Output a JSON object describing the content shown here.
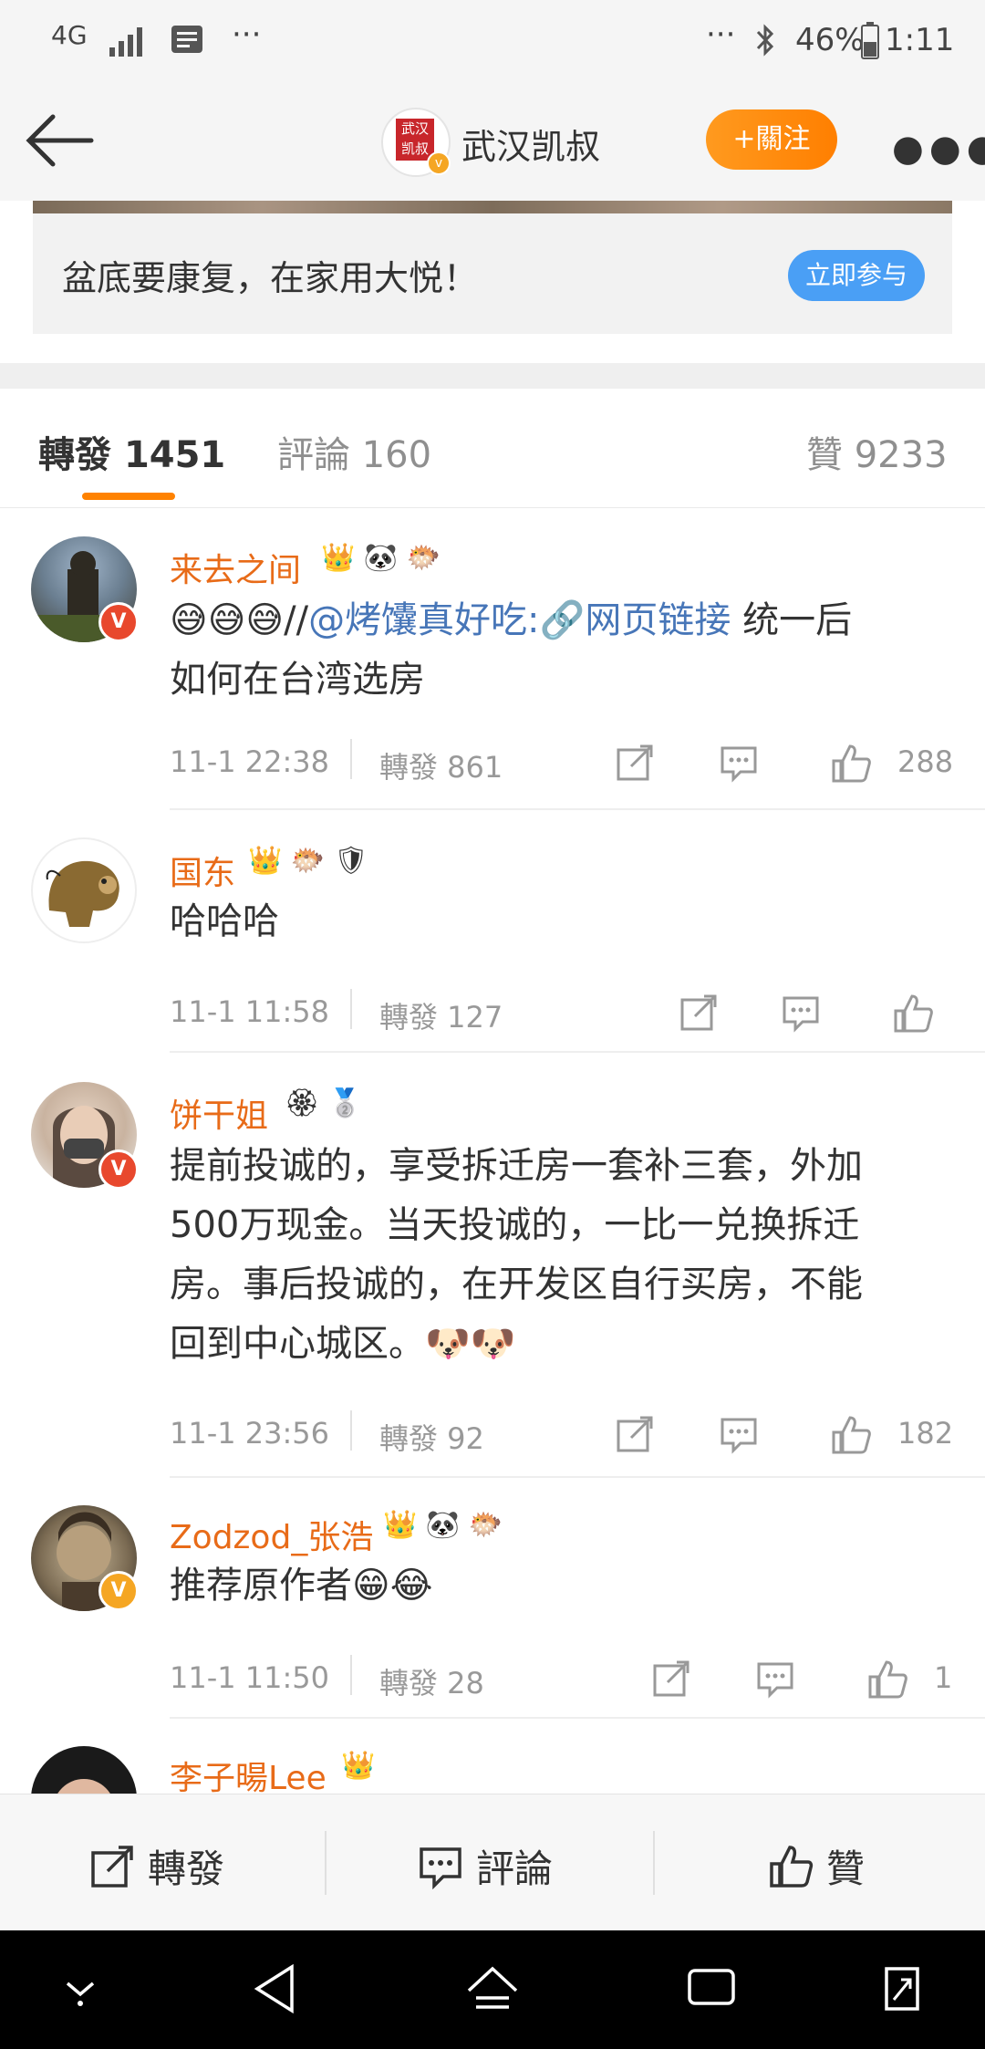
{
  "status_bar": {
    "network": "4G",
    "left_more": "···",
    "right_more": "···",
    "battery": "46%",
    "time": "1:11"
  },
  "nav": {
    "account_name": "武汉凯叔",
    "follow_label": "+關注",
    "avatar_text": "武汉凯叔"
  },
  "banner": {
    "text": "盆底要康复，在家用大悦！",
    "button": "立即参与"
  },
  "tabs": [
    {
      "label": "轉發",
      "count": "1451"
    },
    {
      "label": "評論",
      "count": "160"
    },
    {
      "label": "贊",
      "count": "9233"
    }
  ],
  "comments": [
    {
      "user": "来去之间",
      "text_mention": "@烤馕真好吃:",
      "text_link": "网页链接",
      "text_tail": "统一后",
      "text_line2": "如何在台湾选房",
      "prefix": "//",
      "date": "11-1 22:38",
      "forward_label": "轉發 861",
      "likes": "288"
    },
    {
      "user": "国东",
      "text": "哈哈哈",
      "date": "11-1 11:58",
      "forward_label": "轉發 127",
      "likes": ""
    },
    {
      "user": "饼干姐",
      "text_lines": [
        "提前投诚的，享受拆迁房一套补三套，外加",
        "500万现金。当天投诚的，一比一兑换拆迁",
        "房。事后投诚的，在开发区自行买房，不能",
        "回到中心城区。"
      ],
      "date": "11-1 23:56",
      "forward_label": "轉發 92",
      "likes": "182"
    },
    {
      "user": "Zodzod_张浩",
      "text": "推荐原作者",
      "date": "11-1 11:50",
      "forward_label": "轉發 28",
      "likes": "1"
    },
    {
      "user": "李子暘Lee"
    }
  ],
  "action_bar": {
    "forward": "轉發",
    "comment": "評論",
    "like": "贊"
  },
  "colors": {
    "accent": "#ff8200",
    "username": "#e86b18",
    "link": "#4776b8",
    "button_blue": "#4a9ff5"
  }
}
